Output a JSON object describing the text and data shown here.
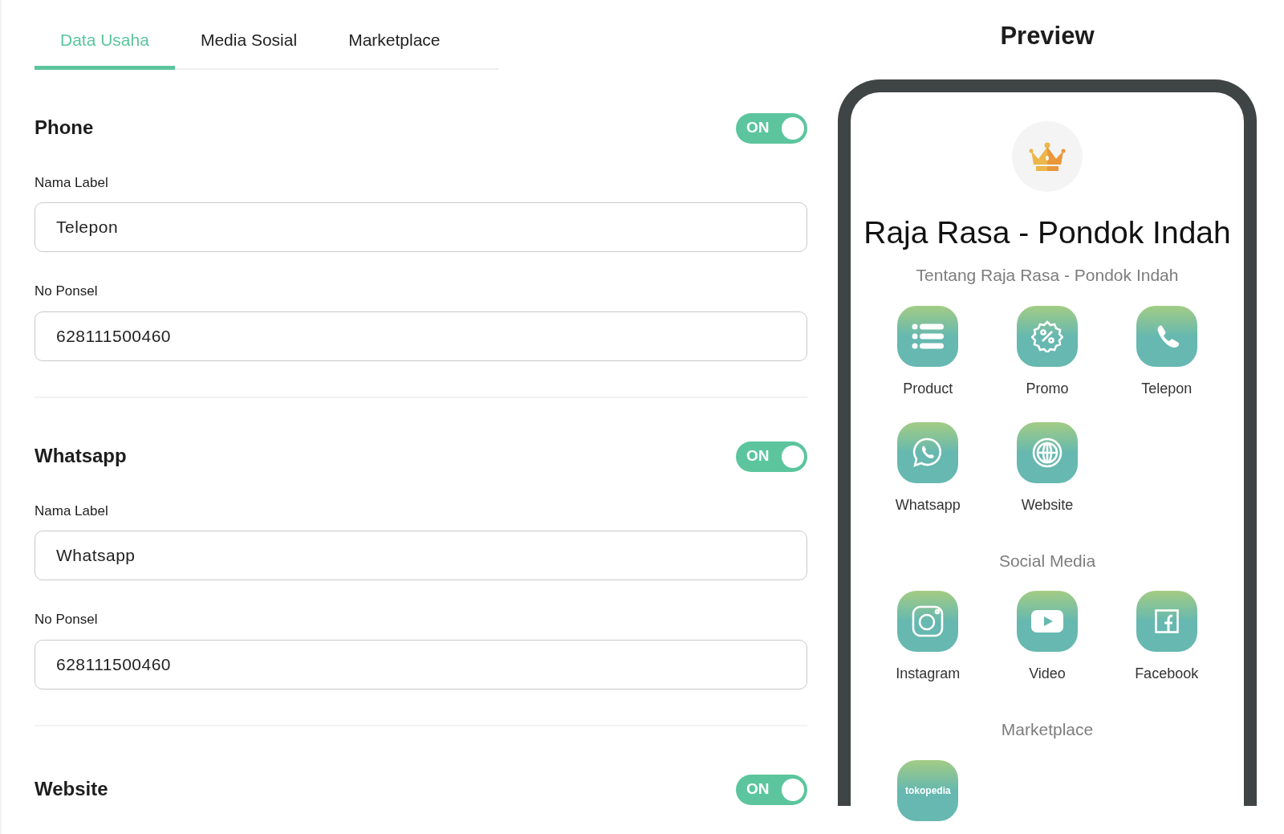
{
  "tabs": [
    {
      "label": "Data Usaha",
      "selected": true
    },
    {
      "label": "Media Sosial",
      "selected": false
    },
    {
      "label": "Marketplace",
      "selected": false
    }
  ],
  "sections": [
    {
      "title": "Phone",
      "toggle": {
        "label": "ON",
        "on": true
      },
      "fields": [
        {
          "label": "Nama Label",
          "value": "Telepon"
        },
        {
          "label": "No Ponsel",
          "value": "628111500460"
        }
      ]
    },
    {
      "title": "Whatsapp",
      "toggle": {
        "label": "ON",
        "on": true
      },
      "fields": [
        {
          "label": "Nama Label",
          "value": "Whatsapp"
        },
        {
          "label": "No Ponsel",
          "value": "628111500460"
        }
      ]
    },
    {
      "title": "Website",
      "toggle": {
        "label": "ON",
        "on": true
      }
    }
  ],
  "preview": {
    "heading": "Preview",
    "business_name": "Raja Rasa - Pondok Indah",
    "tagline": "Tentang Raja Rasa - Pondok Indah",
    "groups": [
      {
        "items": [
          {
            "kind": "list",
            "label": "Product"
          },
          {
            "kind": "promo",
            "label": "Promo"
          },
          {
            "kind": "phone",
            "label": "Telepon"
          },
          {
            "kind": "whatsapp",
            "label": "Whatsapp"
          },
          {
            "kind": "globe",
            "label": "Website"
          }
        ]
      },
      {
        "heading": "Social Media",
        "items": [
          {
            "kind": "instagram",
            "label": "Instagram"
          },
          {
            "kind": "video",
            "label": "Video"
          },
          {
            "kind": "facebook",
            "label": "Facebook"
          }
        ]
      },
      {
        "heading": "Marketplace",
        "items": [
          {
            "kind": "wordmark",
            "logo_text": "tokopedia"
          }
        ]
      }
    ]
  }
}
